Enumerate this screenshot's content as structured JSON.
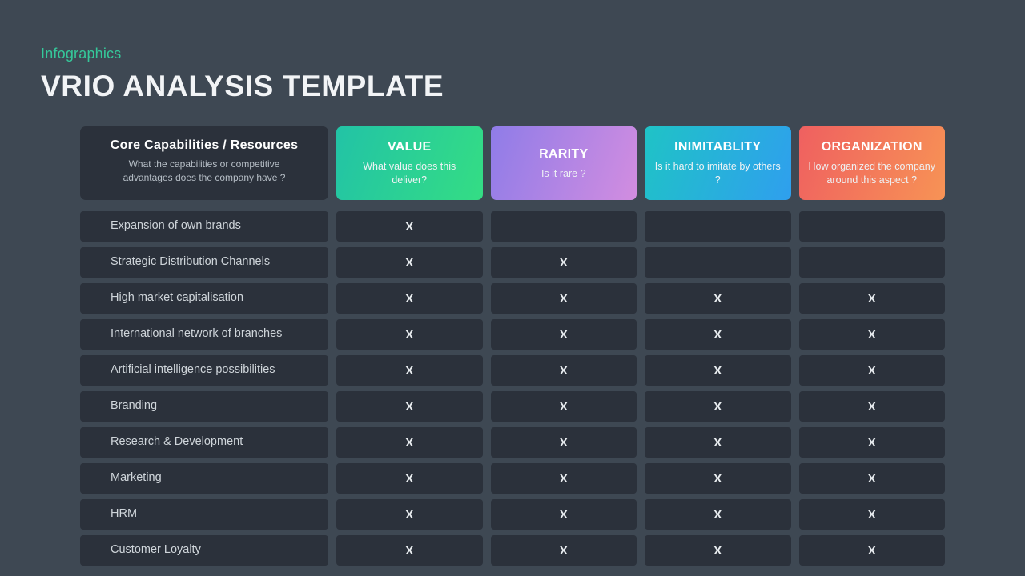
{
  "header": {
    "eyebrow": "Infographics",
    "title": "VRIO ANALYSIS TEMPLATE"
  },
  "matrix": {
    "columns": [
      {
        "title": "Core Capabilities / Resources",
        "subtitle": "What the capabilities or competitive advantages  does the company have  ?",
        "style": "plain",
        "gradient_from": "#2b313b",
        "gradient_to": "#2b313b"
      },
      {
        "title": "VALUE",
        "subtitle": "What value  does this deliver?",
        "style": "accent",
        "gradient_from": "#22c3a6",
        "gradient_to": "#34dd84"
      },
      {
        "title": "RARITY",
        "subtitle": "Is it rare  ?",
        "style": "accent",
        "gradient_from": "#8f7ce8",
        "gradient_to": "#d28de0"
      },
      {
        "title": "INIMITABLITY",
        "subtitle": "Is it hard to imitate by others ?",
        "style": "accent",
        "gradient_from": "#1fc3c6",
        "gradient_to": "#2f9fee"
      },
      {
        "title": "ORGANIZATION",
        "subtitle": "How organized  the company around  this aspect ?",
        "style": "accent",
        "gradient_from": "#ef6060",
        "gradient_to": "#f79355"
      }
    ],
    "mark": "X",
    "rows": [
      {
        "label": "Expansion of own brands",
        "marks": [
          "X",
          "",
          "",
          ""
        ]
      },
      {
        "label": "Strategic Distribution  Channels",
        "marks": [
          "X",
          "X",
          "",
          ""
        ]
      },
      {
        "label": "High market capitalisation",
        "marks": [
          "X",
          "X",
          "X",
          "X"
        ]
      },
      {
        "label": "International  network of branches",
        "marks": [
          "X",
          "X",
          "X",
          "X"
        ]
      },
      {
        "label": "Artificial intelligence possibilities",
        "marks": [
          "X",
          "X",
          "X",
          "X"
        ]
      },
      {
        "label": "Branding",
        "marks": [
          "X",
          "X",
          "X",
          "X"
        ]
      },
      {
        "label": "Research & Development",
        "marks": [
          "X",
          "X",
          "X",
          "X"
        ]
      },
      {
        "label": "Marketing",
        "marks": [
          "X",
          "X",
          "X",
          "X"
        ]
      },
      {
        "label": "HRM",
        "marks": [
          "X",
          "X",
          "X",
          "X"
        ]
      },
      {
        "label": "Customer Loyalty",
        "marks": [
          "X",
          "X",
          "X",
          "X"
        ]
      }
    ]
  },
  "colors": {
    "background": "#3e4853",
    "cell": "#2b313b",
    "accent": "#35c89a",
    "title_text": "#f2f4f6",
    "label_text": "#cfd5da",
    "mark_text": "#e8ecef"
  }
}
